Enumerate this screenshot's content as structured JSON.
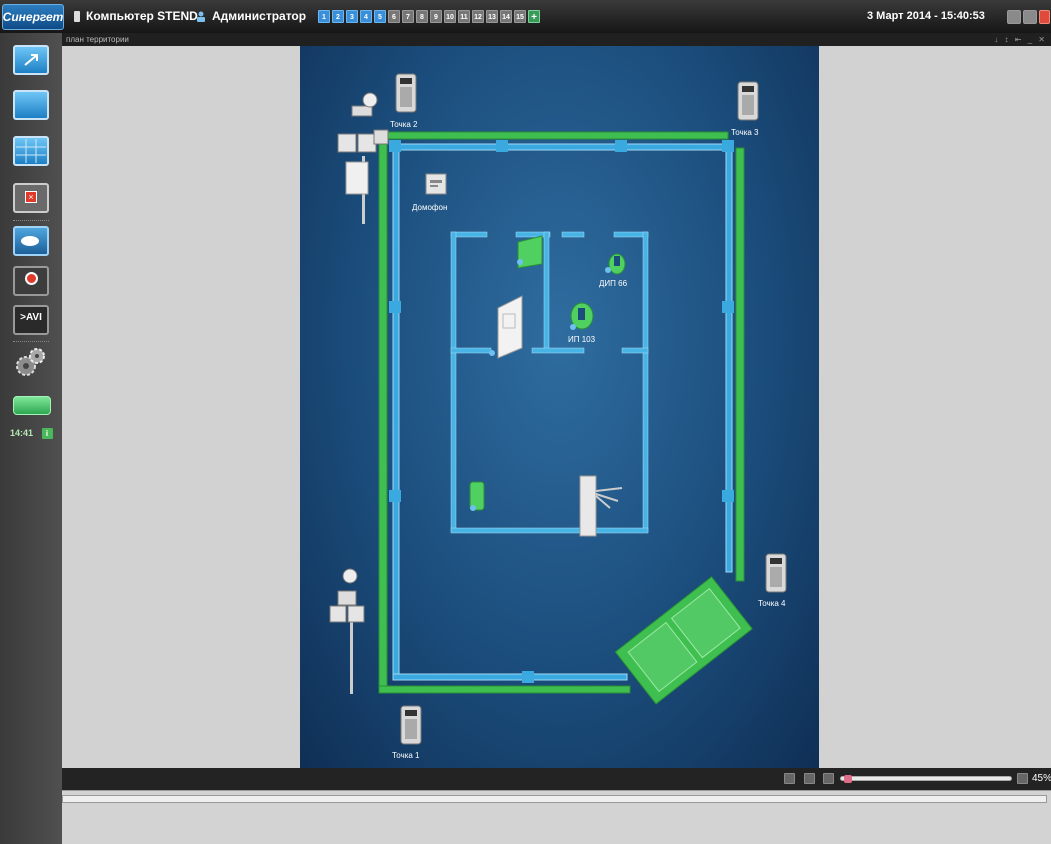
{
  "app": {
    "logo": "Синергет",
    "computer": "Компьютер STEND",
    "user": "Администратор",
    "datetime": "3 Март 2014 - 15:40:53"
  },
  "pages": [
    {
      "label": "1",
      "active": true
    },
    {
      "label": "2",
      "active": true
    },
    {
      "label": "3",
      "active": true
    },
    {
      "label": "4",
      "active": true
    },
    {
      "label": "5",
      "active": true
    },
    {
      "label": "6",
      "active": false
    },
    {
      "label": "7",
      "active": false
    },
    {
      "label": "8",
      "active": false
    },
    {
      "label": "9",
      "active": false
    },
    {
      "label": "10",
      "active": false
    },
    {
      "label": "11",
      "active": false
    },
    {
      "label": "12",
      "active": false
    },
    {
      "label": "13",
      "active": false
    },
    {
      "label": "14",
      "active": false
    },
    {
      "label": "15",
      "active": false
    }
  ],
  "add_page_label": "+",
  "sidebar": {
    "time": "14:41",
    "avi_label": ">AVI"
  },
  "map": {
    "title": "план территории",
    "labels": {
      "point1": "Точка 1",
      "point2": "Точка 2",
      "point3": "Точка 3",
      "point4": "Точка 4",
      "intercom": "Домофон",
      "dip": "ДИП 66",
      "ip": "ИП 103"
    }
  },
  "playbar": {
    "zoom": "45%",
    "progress": 0.02
  },
  "colors": {
    "fence": "#3fbf4f",
    "wall": "#3aa9e0",
    "map_bg": "#1b4d7c",
    "accent": "#3a8fd8"
  }
}
